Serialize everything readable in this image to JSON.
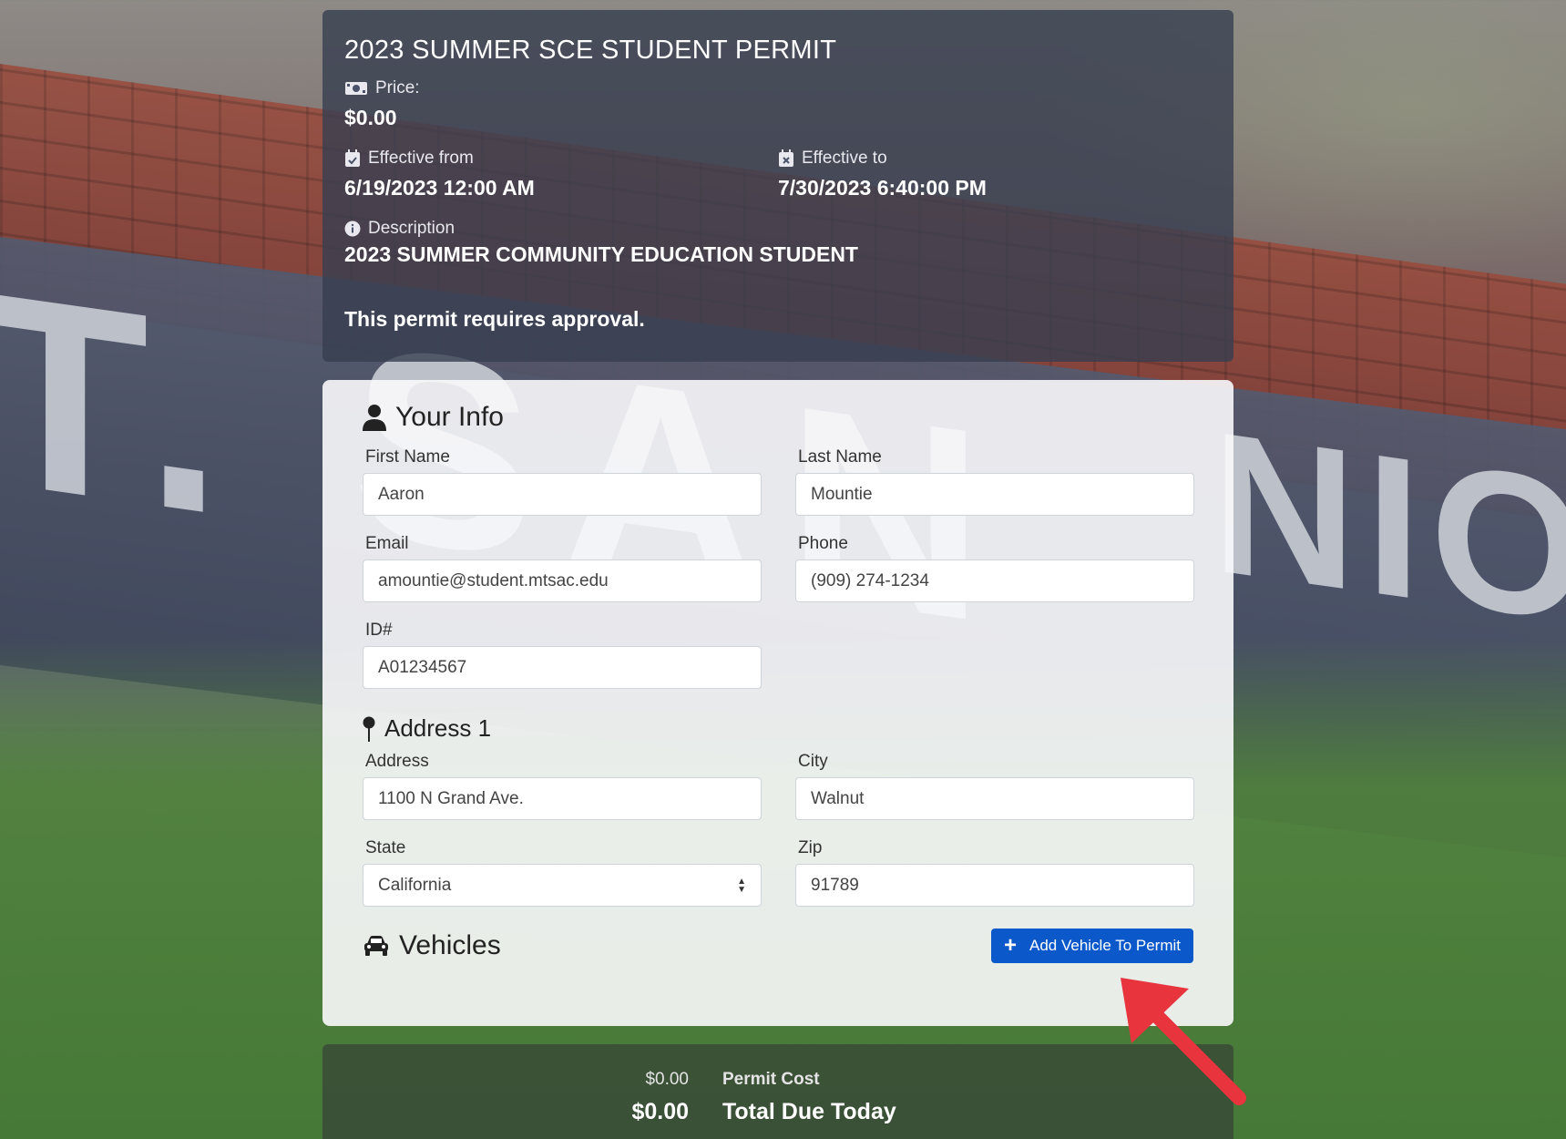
{
  "permit": {
    "title": "2023 SUMMER SCE STUDENT PERMIT",
    "price_label": "Price:",
    "price_value": "$0.00",
    "effective_from_label": "Effective from",
    "effective_from_value": "6/19/2023 12:00 AM",
    "effective_to_label": "Effective to",
    "effective_to_value": "7/30/2023 6:40:00 PM",
    "description_label": "Description",
    "description_value": "2023 SUMMER COMMUNITY EDUCATION STUDENT",
    "approval_note": "This permit requires approval."
  },
  "your_info": {
    "heading": "Your Info",
    "first_name": {
      "label": "First Name",
      "value": "Aaron"
    },
    "last_name": {
      "label": "Last Name",
      "value": "Mountie"
    },
    "email": {
      "label": "Email",
      "value": "amountie@student.mtsac.edu"
    },
    "phone": {
      "label": "Phone",
      "value": "(909) 274-1234"
    },
    "id": {
      "label": "ID#",
      "value": "A01234567"
    }
  },
  "address": {
    "heading": "Address 1",
    "street": {
      "label": "Address",
      "value": "1100 N Grand Ave."
    },
    "city": {
      "label": "City",
      "value": "Walnut"
    },
    "state": {
      "label": "State",
      "value": "California"
    },
    "zip": {
      "label": "Zip",
      "value": "91789"
    }
  },
  "vehicles": {
    "heading": "Vehicles",
    "add_button_label": "Add Vehicle To Permit"
  },
  "totals": {
    "permit_cost_value": "$0.00",
    "permit_cost_label": "Permit Cost",
    "total_due_value": "$0.00",
    "total_due_label": "Total Due Today"
  },
  "background": {
    "sign_text_left": "T.  SAN",
    "sign_text_right": "NIO C"
  },
  "colors": {
    "primary_button": "#0a58ca",
    "annotation_arrow": "#e8343d"
  }
}
